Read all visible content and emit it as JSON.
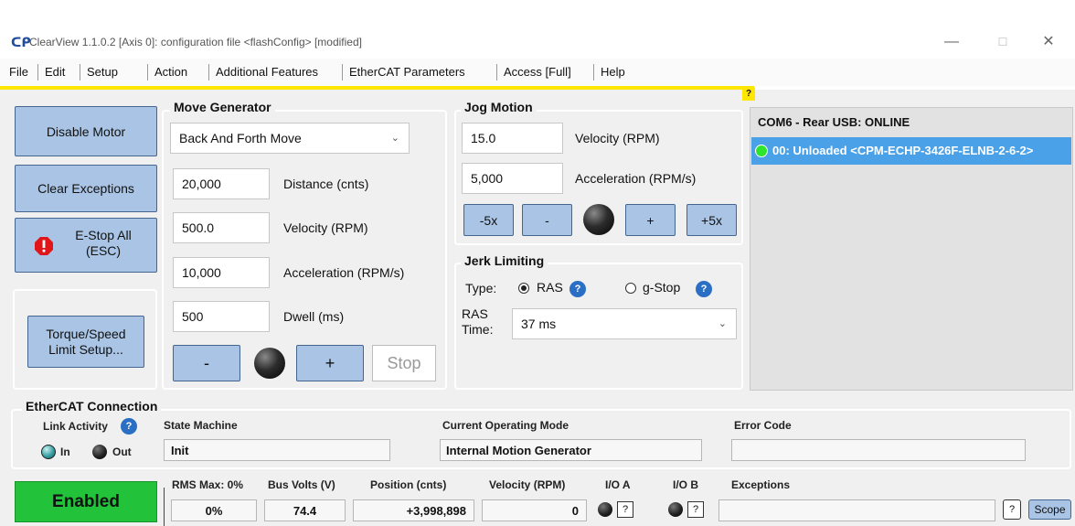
{
  "window": {
    "logo": "ᑕᑭ",
    "title": "ClearView 1.1.0.2 [Axis 0]: configuration file <flashConfig> [modified]",
    "controls": {
      "minimize": "—",
      "maximize": "☐",
      "close": "✕"
    }
  },
  "menu": [
    "File",
    "Edit",
    "Setup",
    "Action",
    "Additional Features",
    "EtherCAT Parameters",
    "Access [Full]",
    "Help"
  ],
  "menu_help_marker": "?",
  "left_buttons": {
    "disable": "Disable Motor",
    "clear": "Clear Exceptions",
    "estop": "E-Stop All\n(ESC)",
    "torque": "Torque/Speed\nLimit Setup..."
  },
  "move_generator": {
    "title": "Move Generator",
    "mode": "Back And Forth Move",
    "distance": {
      "value": "20,000",
      "label": "Distance (cnts)"
    },
    "velocity": {
      "value": "500.0",
      "label": "Velocity (RPM)"
    },
    "acceleration": {
      "value": "10,000",
      "label": "Acceleration (RPM/s)"
    },
    "dwell": {
      "value": "500",
      "label": "Dwell (ms)"
    },
    "minus": "-",
    "plus": "+",
    "stop": "Stop"
  },
  "jog_motion": {
    "title": "Jog Motion",
    "velocity": {
      "value": "15.0",
      "label": "Velocity (RPM)"
    },
    "acceleration": {
      "value": "5,000",
      "label": "Acceleration (RPM/s)"
    },
    "buttons": [
      "-5x",
      "-",
      "+",
      "+5x"
    ]
  },
  "jerk_limiting": {
    "title": "Jerk Limiting",
    "type_label": "Type:",
    "opt_ras": "RAS",
    "opt_gstop": "g-Stop",
    "ras_time_label": "RAS\nTime:",
    "ras_time": "37 ms"
  },
  "devices": {
    "header": "COM6 - Rear USB: ONLINE",
    "node": "00: Unloaded <CPM-ECHP-3426F-ELNB-2-6-2>"
  },
  "ethercat": {
    "title": "EtherCAT Connection",
    "link_activity": "Link Activity",
    "in": "In",
    "out": "Out",
    "state_machine_label": "State Machine",
    "state_machine": "Init",
    "op_mode_label": "Current Operating Mode",
    "op_mode": "Internal Motion Generator",
    "error_code_label": "Error Code",
    "error_code": ""
  },
  "status": {
    "enabled": "Enabled",
    "rms_label": "RMS Max: 0%",
    "rms": "0%",
    "bus_label": "Bus Volts (V)",
    "bus": "74.4",
    "pos_label": "Position (cnts)",
    "pos": "+3,998,898",
    "vel_label": "Velocity (RPM)",
    "vel": "0",
    "ioa_label": "I/O A",
    "iob_label": "I/O B",
    "io_q": "?",
    "exc_label": "Exceptions",
    "exc": "",
    "exc_q": "?",
    "scope": "Scope"
  },
  "colors": {
    "button_blue": "#a9c4e4",
    "enabled_green": "#22c33a",
    "selection_blue": "#4aa1e8",
    "menu_accent": "#ffe600"
  }
}
